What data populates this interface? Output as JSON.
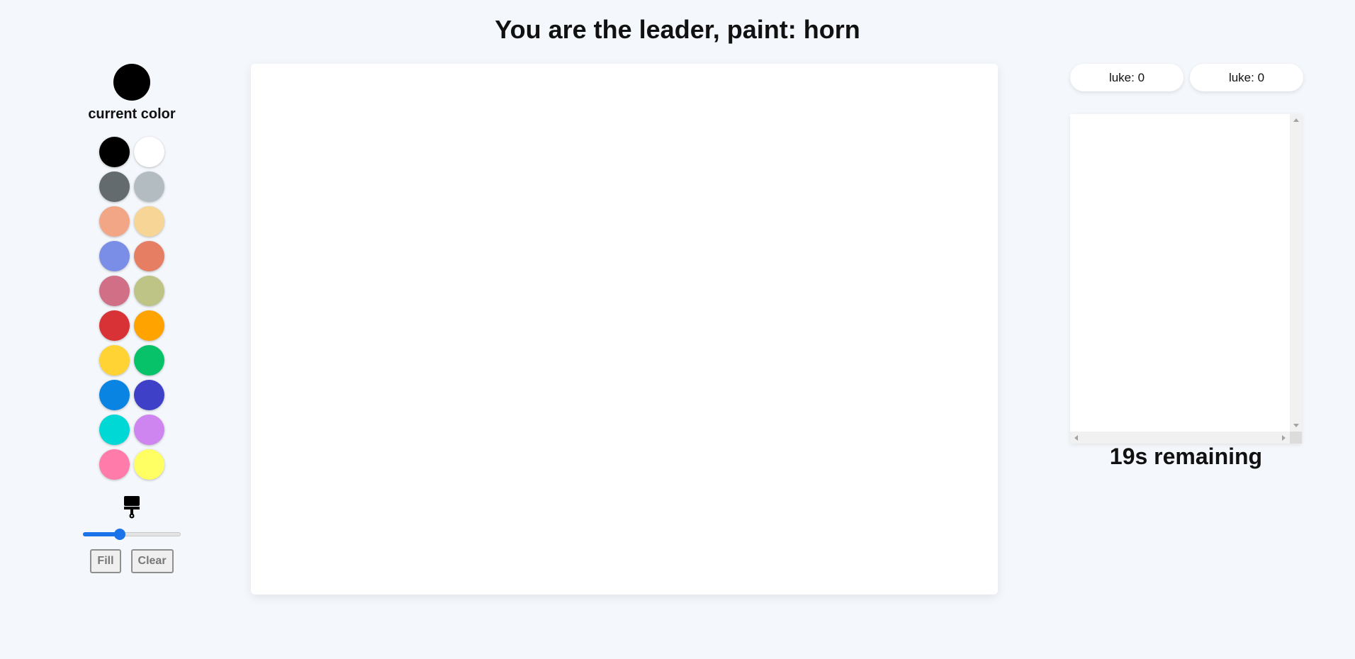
{
  "header": {
    "title": "You are the leader, paint: horn"
  },
  "tools": {
    "current_color": "#000000",
    "current_color_label": "current color",
    "palette": [
      "#000000",
      "#ffffff",
      "#636b6f",
      "#b2bcc1",
      "#f3a686",
      "#f6d596",
      "#7a8ee8",
      "#e67e63",
      "#d06f86",
      "#bec486",
      "#d93236",
      "#ffa300",
      "#ffd334",
      "#07c268",
      "#0984e3",
      "#3e40c8",
      "#00d8d6",
      "#ce85f0",
      "#ff7ba9",
      "#ffff63"
    ],
    "brush_icon": "paint-brush-icon",
    "brush_size_fraction": 0.38,
    "accent_color": "#1a73e8",
    "fill_label": "Fill",
    "clear_label": "Clear"
  },
  "canvas": {
    "background": "#ffffff"
  },
  "scores": [
    {
      "text": "luke: 0"
    },
    {
      "text": "luke: 0"
    }
  ],
  "timer": {
    "text": "19s remaining"
  }
}
